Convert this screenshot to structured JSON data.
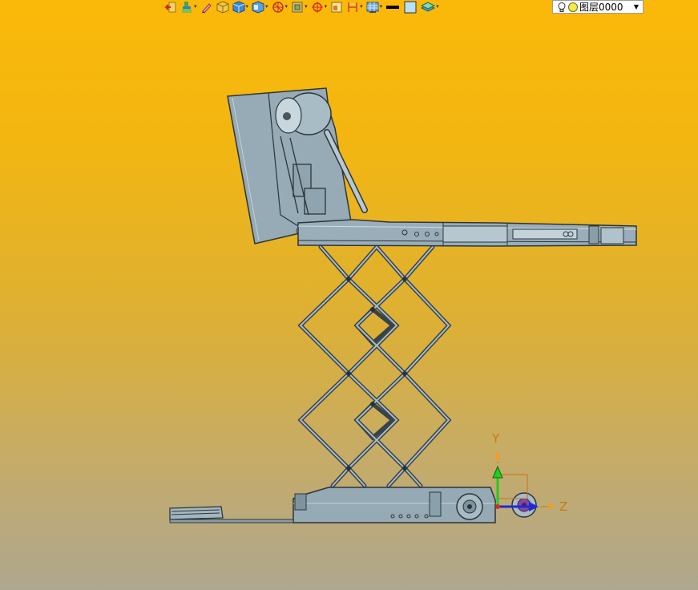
{
  "toolbar": {
    "items": [
      {
        "icon": "exit-sketch-icon"
      },
      {
        "icon": "paint-brush-icon",
        "dropdown": true
      },
      {
        "icon": "pencil-icon"
      },
      {
        "icon": "shaded-cube-icon"
      },
      {
        "icon": "cube-view-icon",
        "dropdown": true
      },
      {
        "icon": "section-cube-icon",
        "dropdown": true
      },
      {
        "icon": "wcs-orient-icon",
        "dropdown": true
      },
      {
        "icon": "view-box-icon",
        "dropdown": true
      },
      {
        "icon": "snap-target-icon",
        "dropdown": true
      },
      {
        "icon": "page-view-icon"
      },
      {
        "icon": "dimension-icon",
        "dropdown": true
      },
      {
        "icon": "display-grid-icon",
        "dropdown": true
      },
      {
        "icon": "line-color-icon"
      },
      {
        "icon": "fill-color-icon"
      },
      {
        "icon": "layer-stack-icon",
        "dropdown": true
      }
    ],
    "layer_select": {
      "value": "图层0000"
    }
  },
  "colors": {
    "part_fill": "#95aab5",
    "part_dark": "#3c4850",
    "bg_top": "#fbb808",
    "bg_bottom": "#aea78f",
    "axis_y": "#22cc22",
    "axis_z": "#1e2ad8",
    "axis_label": "#c87a10"
  },
  "triad": {
    "y_label": "Y",
    "z_label": "Z"
  }
}
